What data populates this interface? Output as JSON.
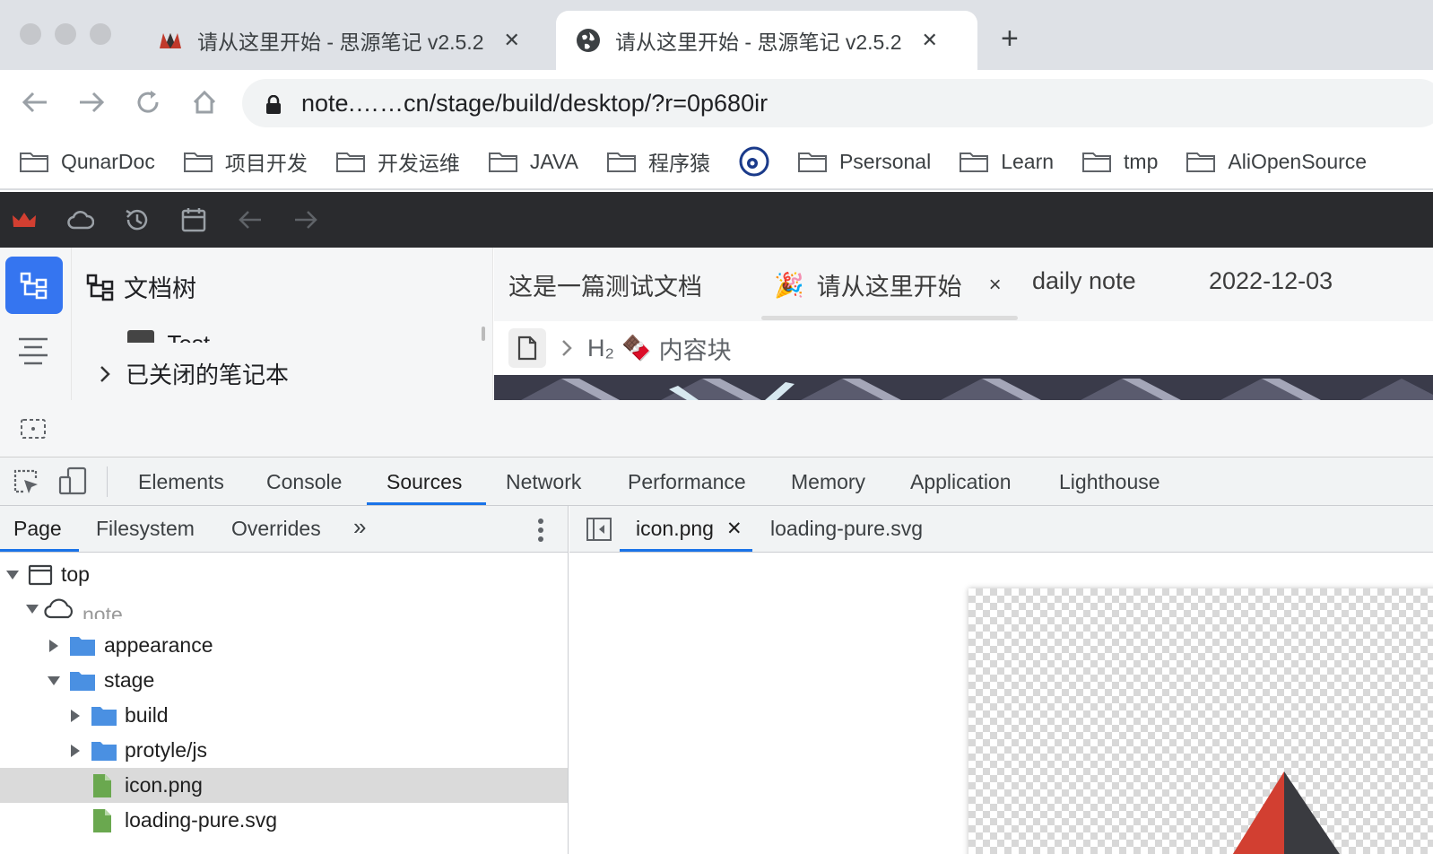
{
  "browser": {
    "tabs": [
      {
        "title": "请从这里开始 - 思源笔记 v2.5.2",
        "favicon": "siyuan-logo-icon",
        "active": false
      },
      {
        "title": "请从这里开始 - 思源笔记 v2.5.2",
        "favicon": "globe-icon",
        "active": true
      }
    ],
    "tab_close": "✕",
    "new_tab": "+",
    "url": "note.……cn/stage/build/desktop/?r=0p680ir",
    "bookmarks": [
      "QunarDoc",
      "项目开发",
      "开发运维",
      "JAVA",
      "程序猿",
      "",
      "Psersonal",
      "Learn",
      "tmp",
      "AliOpenSource"
    ]
  },
  "siyuan": {
    "dock": {
      "file_tree_title": "文档树"
    },
    "tree": {
      "partial_item": "Test",
      "closed_notebooks": "已关闭的笔记本"
    },
    "tabs": [
      {
        "label": "这是一篇测试文档"
      },
      {
        "label": "请从这里开始",
        "emoji": "🎉",
        "close": "×",
        "active": true
      },
      {
        "label": "daily note"
      },
      {
        "label": "2022-12-03"
      }
    ],
    "breadcrumb": {
      "heading": "H₂",
      "emoji": "🍫",
      "label": "内容块"
    }
  },
  "devtools": {
    "panels": [
      "Elements",
      "Console",
      "Sources",
      "Network",
      "Performance",
      "Memory",
      "Application",
      "Lighthouse"
    ],
    "active_panel": "Sources",
    "navigator_tabs": [
      "Page",
      "Filesystem",
      "Overrides"
    ],
    "more_tabs": "»",
    "tree": {
      "top": "top",
      "domain": "note…",
      "appearance": "appearance",
      "stage": "stage",
      "build": "build",
      "protyle": "protyle/js",
      "icon": "icon.png",
      "loading": "loading-pure.svg"
    },
    "editor_tabs": [
      {
        "label": "icon.png",
        "close": "✕",
        "active": true
      },
      {
        "label": "loading-pure.svg"
      }
    ]
  },
  "colors": {
    "accent": "#1a73e8",
    "siyuan_blue": "#3575f0",
    "siyuan_dark": "#2a2b2e",
    "folder_blue": "#4a90e2",
    "file_green": "#6aa84f",
    "crown_red": "#d23f31"
  }
}
